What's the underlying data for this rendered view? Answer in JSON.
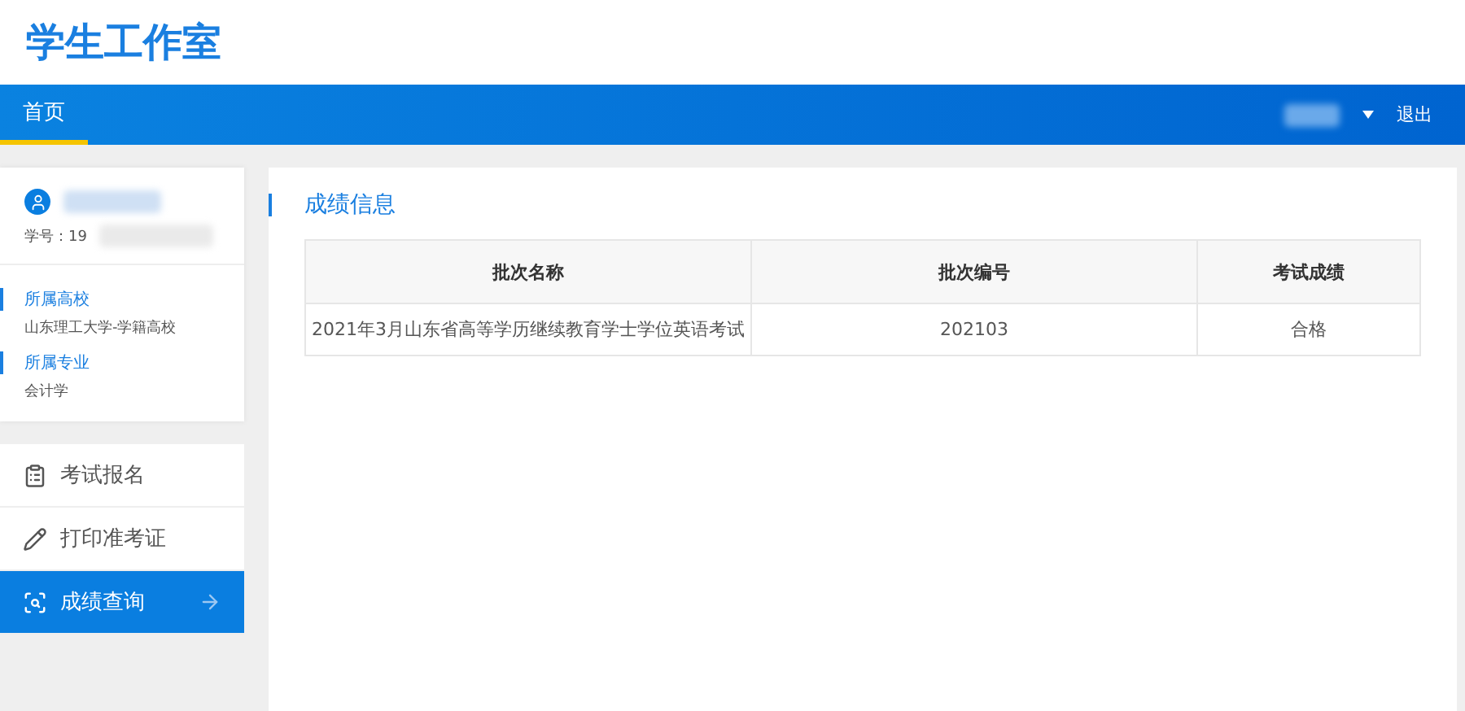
{
  "header": {
    "title": "学生工作室"
  },
  "nav": {
    "items": [
      {
        "label": "首页",
        "selected": true
      }
    ],
    "logout": "退出"
  },
  "profile": {
    "student_id": "学号：19",
    "sections": [
      {
        "label": "所属高校",
        "value": "山东理工大学-学籍高校"
      },
      {
        "label": "所属专业",
        "value": "会计学"
      }
    ]
  },
  "menu": [
    {
      "label": "考试报名",
      "selected": false
    },
    {
      "label": "打印准考证",
      "selected": false
    },
    {
      "label": "成绩查询",
      "selected": true
    }
  ],
  "main": {
    "title": "成绩信息",
    "table": {
      "columns": [
        "批次名称",
        "批次编号",
        "考试成绩"
      ],
      "rows": [
        [
          "2021年3月山东省高等学历继续教育学士学位英语考试",
          "202103",
          "合格"
        ]
      ]
    }
  }
}
